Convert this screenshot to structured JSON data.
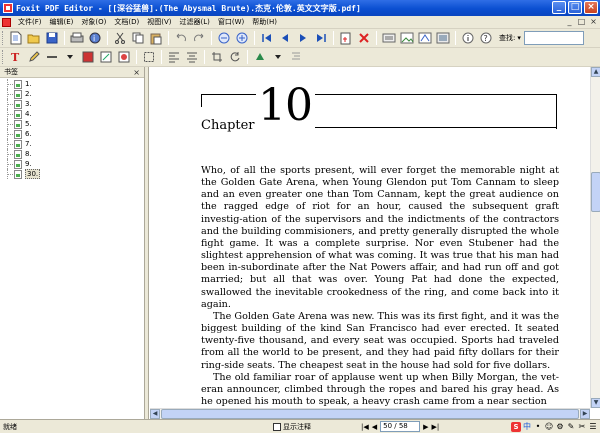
{
  "window": {
    "title": "Foxit PDF Editor - [[深谷猛兽].(The Abysmal Brute).杰克·伦敦.英文文字版.pdf]",
    "controls": [
      "_",
      "□",
      "×"
    ]
  },
  "menu": {
    "items": [
      "文件(F)",
      "编辑(E)",
      "对象(O)",
      "文档(D)",
      "视图(V)",
      "过滤器(L)",
      "窗口(W)",
      "帮助(H)"
    ],
    "right_controls": [
      "_",
      "□",
      "×"
    ]
  },
  "toolbar1": {
    "icons": [
      "new-doc",
      "open-folder",
      "save",
      "print",
      "properties",
      "cut",
      "copy",
      "paste",
      "undo",
      "redo",
      "zoom-out",
      "zoom-in",
      "first-page",
      "prev-page",
      "next-page",
      "last-page",
      "insert-page",
      "delete-page",
      "object-a",
      "object-b",
      "object-c",
      "object-d",
      "info",
      "help"
    ],
    "find_label": "查找:",
    "find_value": ""
  },
  "bookmarks_panel": {
    "title": "书签",
    "close": "×",
    "items": [
      "1.",
      "2.",
      "3.",
      "4.",
      "5.",
      "6.",
      "7.",
      "8.",
      "9.",
      "30."
    ],
    "selected_index": 9
  },
  "document": {
    "chapter_word": "Chapter",
    "chapter_number": "10",
    "paragraphs": [
      "Who, of all the sports present, will ever forget the memorable night at the Golden Gate Arena, when Young Glendon put Tom Cannam to sleep and an even greater one than Tom Cannam, kept the great audience on the ragged edge of riot for an hour, caused the subsequent graft investig-ation of the supervisors and the indictments of the contractors and the building commisioners, and pretty generally disrupted the whole fight game. It was a complete surprise. Nor even Stubener had the slightest apprehension of what was coming. It was true that his man had been in-subordinate after the Nat Powers affair, and had run off and got married; but all that was over. Young Pat had done the expected, swallowed the inevitable crookedness of the ring, and come back into it again.",
      "The Golden Gate Arena was new. This was its first fight, and it was the biggest building of the kind San Francisco had ever erected. It seated twenty-five thousand, and every seat was occupied. Sports had traveled from all the world to be present, and they had paid fifty dollars for their ring-side seats. The cheapest seat in the house had sold for five dollars.",
      "The old familiar roar of applause went up when Billy Morgan, the vet-eran announcer, climbed through the ropes and bared his gray head. As he opened his mouth to speak, a heavy crash came from a near section"
    ]
  },
  "status": {
    "text": "就绪",
    "show_annotations_label": "显示注释",
    "page_display": "50 / 58"
  },
  "tray": [
    "S",
    "中",
    "•",
    "☺",
    "⚙",
    "✎",
    "✂",
    "☰"
  ]
}
